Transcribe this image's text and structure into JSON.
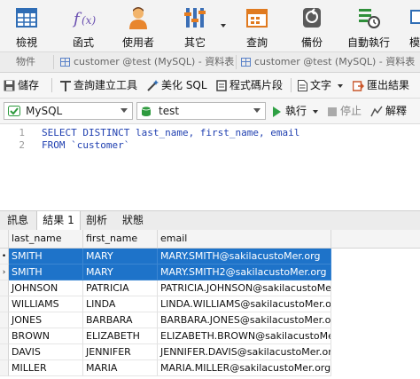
{
  "toolbar": {
    "items": [
      {
        "label": "檢視",
        "icon": "grid-table-icon"
      },
      {
        "label": "函式",
        "icon": "function-fx-icon"
      },
      {
        "label": "使用者",
        "icon": "user-icon"
      },
      {
        "label": "其它",
        "icon": "tools-icon"
      },
      {
        "label": "查詢",
        "icon": "query-icon"
      },
      {
        "label": "備份",
        "icon": "backup-icon"
      },
      {
        "label": "自動執行",
        "icon": "schedule-icon"
      },
      {
        "label": "模",
        "icon": "model-icon"
      }
    ]
  },
  "tabs": {
    "objects": "物件",
    "tab1": "customer @test (MySQL) - 資料表",
    "tab2": "customer @test (MySQL) - 資料表"
  },
  "editor_toolbar": {
    "save": "儲存",
    "query_builder": "查詢建立工具",
    "beautify": "美化 SQL",
    "code_snippet": "程式碼片段",
    "text": "文字",
    "export": "匯出結果"
  },
  "connection": {
    "server": "MySQL",
    "database": "test",
    "run": "執行",
    "stop": "停止",
    "explain": "解釋"
  },
  "sql": {
    "line1_no": "1",
    "line2_no": "2",
    "line1": "SELECT DISTINCT last_name, first_name, email",
    "line2": "FROM `customer`"
  },
  "result_tabs": [
    "訊息",
    "結果 1",
    "剖析",
    "狀態"
  ],
  "grid": {
    "columns": [
      "last_name",
      "first_name",
      "email"
    ],
    "rows": [
      [
        "SMITH",
        "MARY",
        "MARY.SMITH@sakilacustoMer.org"
      ],
      [
        "SMITH",
        "MARY",
        "MARY.SMITH2@sakilacustoMer.org"
      ],
      [
        "JOHNSON",
        "PATRICIA",
        "PATRICIA.JOHNSON@sakilacustoMer.org"
      ],
      [
        "WILLIAMS",
        "LINDA",
        "LINDA.WILLIAMS@sakilacustoMer.org"
      ],
      [
        "JONES",
        "BARBARA",
        "BARBARA.JONES@sakilacustoMer.org"
      ],
      [
        "BROWN",
        "ELIZABETH",
        "ELIZABETH.BROWN@sakilacustoMer.org"
      ],
      [
        "DAVIS",
        "JENNIFER",
        "JENNIFER.DAVIS@sakilacustoMer.org"
      ],
      [
        "MILLER",
        "MARIA",
        "MARIA.MILLER@sakilacustoMer.org"
      ]
    ],
    "indicators": [
      "•",
      "›",
      "",
      "",
      "",
      "",
      "",
      ""
    ]
  },
  "colors": {
    "selection": "#1e73c9",
    "keyword": "#1f3fb0",
    "run": "#2ea043"
  }
}
